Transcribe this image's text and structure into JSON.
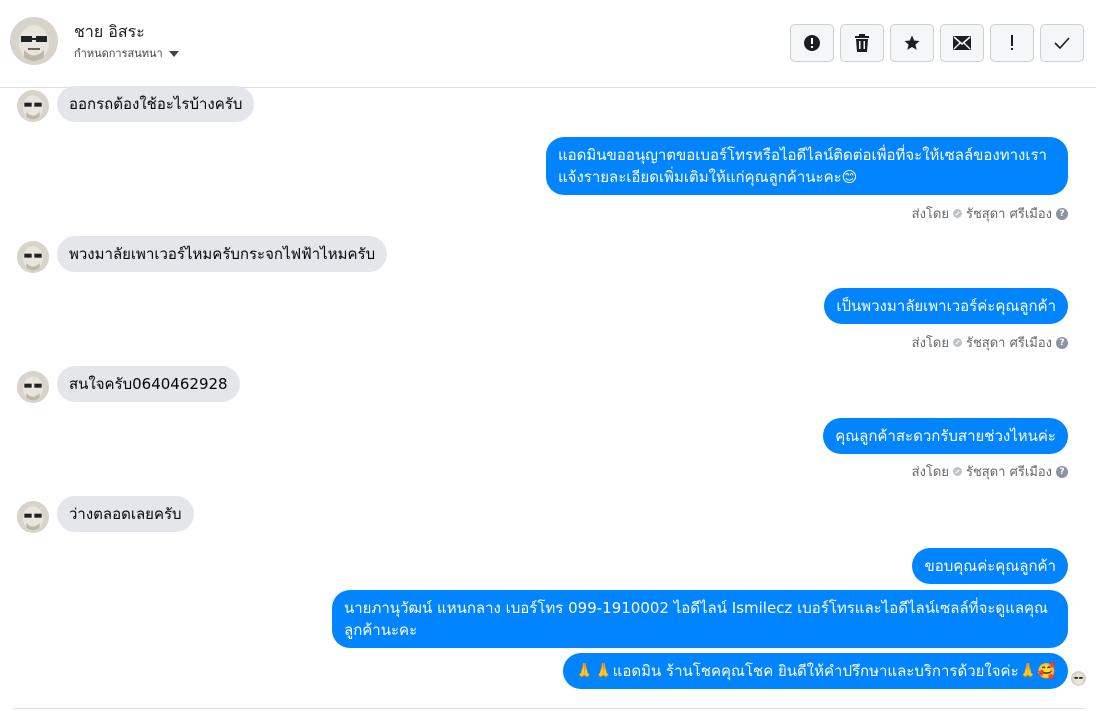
{
  "header": {
    "name": "ชาย อิสระ",
    "sub_label": "กำหนดการสนทนา",
    "actions": [
      "alert-circle-icon",
      "trash-icon",
      "star-icon",
      "envelope-icon",
      "exclamation-icon",
      "check-icon"
    ]
  },
  "colors": {
    "outgoing": "#0084ff",
    "incoming": "#e4e6eb"
  },
  "messages": [
    {
      "dir": "in",
      "text": "ออกรถต้องใช้อะไรบ้างครับ"
    },
    {
      "dir": "out",
      "lines": [
        "แอดมินขออนุญาตขอเบอร์โทรหรือไอดีไลน์ติดต่อเพื่อที่จะให้เซลล์ของทางเรา",
        "แจ้งรายละเอียดเพิ่มเติมให้แก่คุณลูกค้านะคะ😊"
      ]
    },
    {
      "dir": "in",
      "text": "พวงมาลัยเพาเวอร์ไหมครับกระจกไฟฟ้าไหมครับ"
    },
    {
      "dir": "out",
      "text": "เป็นพวงมาลัยเพาเวอร์ค่ะคุณลูกค้า"
    },
    {
      "dir": "in",
      "text": "สนใจครับ0640462928"
    },
    {
      "dir": "out",
      "text": "คุณลูกค้าสะดวกรับสายช่วงไหนค่ะ"
    },
    {
      "dir": "in",
      "text": "ว่างตลอดเลยครับ"
    },
    {
      "dir": "out",
      "text": "ขอบคุณค่ะคุณลูกค้า"
    },
    {
      "dir": "out",
      "lines": [
        "นายภานุวัฒน์ แหนกลาง เบอร์โทร 099-1910002 ไอดีไลน์ Ismilecz   เบอร์โทรและไอดีไลน์เซลล์ที่จะดูแลคุณ",
        "ลูกค้านะคะ"
      ]
    },
    {
      "dir": "out",
      "text": "🙏🙏แอดมิน ร้านโชคคุณโชค ยินดีให้คำปรึกษาและบริการด้วยใจค่ะ🙏🥰"
    }
  ],
  "sent_by": {
    "prefix": "ส่งโดย",
    "name": "รัชสุดา ศรีเมือง",
    "help": "?"
  }
}
